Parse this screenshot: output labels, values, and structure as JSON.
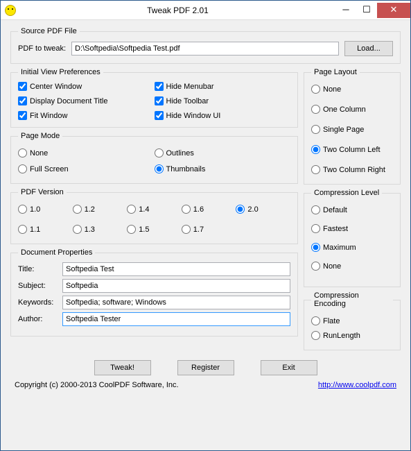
{
  "titlebar": {
    "title": "Tweak PDF 2.01"
  },
  "source": {
    "legend": "Source PDF File",
    "label": "PDF to tweak:",
    "path": "D:\\Softpedia\\Softpedia Test.pdf",
    "load": "Load..."
  },
  "initial_view": {
    "legend": "Initial View Preferences",
    "items": [
      {
        "label": "Center Window",
        "checked": true
      },
      {
        "label": "Hide Menubar",
        "checked": true
      },
      {
        "label": "Display Document Title",
        "checked": true
      },
      {
        "label": "Hide Toolbar",
        "checked": true
      },
      {
        "label": "Fit Window",
        "checked": true
      },
      {
        "label": "Hide Window UI",
        "checked": true
      }
    ]
  },
  "page_mode": {
    "legend": "Page Mode",
    "items": [
      {
        "label": "None",
        "checked": false
      },
      {
        "label": "Outlines",
        "checked": false
      },
      {
        "label": "Full Screen",
        "checked": false
      },
      {
        "label": "Thumbnails",
        "checked": true
      }
    ]
  },
  "pdf_version": {
    "legend": "PDF Version",
    "items": [
      {
        "label": "1.0",
        "checked": false
      },
      {
        "label": "1.2",
        "checked": false
      },
      {
        "label": "1.4",
        "checked": false
      },
      {
        "label": "1.6",
        "checked": false
      },
      {
        "label": "2.0",
        "checked": true
      },
      {
        "label": "1.1",
        "checked": false
      },
      {
        "label": "1.3",
        "checked": false
      },
      {
        "label": "1.5",
        "checked": false
      },
      {
        "label": "1.7",
        "checked": false
      }
    ]
  },
  "doc_props": {
    "legend": "Document Properties",
    "title_label": "Title:",
    "title": "Softpedia Test",
    "subject_label": "Subject:",
    "subject": "Softpedia",
    "keywords_label": "Keywords:",
    "keywords": "Softpedia; software; Windows",
    "author_label": "Author:",
    "author": "Softpedia Tester"
  },
  "page_layout": {
    "legend": "Page Layout",
    "items": [
      {
        "label": "None",
        "checked": false
      },
      {
        "label": "One Column",
        "checked": false
      },
      {
        "label": "Single Page",
        "checked": false
      },
      {
        "label": "Two Column Left",
        "checked": true
      },
      {
        "label": "Two Column Right",
        "checked": false
      }
    ]
  },
  "compression_level": {
    "legend": "Compression Level",
    "items": [
      {
        "label": "Default",
        "checked": false
      },
      {
        "label": "Fastest",
        "checked": false
      },
      {
        "label": "Maximum",
        "checked": true
      },
      {
        "label": "None",
        "checked": false
      }
    ]
  },
  "compression_encoding": {
    "legend": "Compression Encoding",
    "items": [
      {
        "label": "Flate",
        "checked": false
      },
      {
        "label": "RunLength",
        "checked": false
      }
    ]
  },
  "buttons": {
    "tweak": "Tweak!",
    "register": "Register",
    "exit": "Exit"
  },
  "footer": {
    "copyright": "Copyright (c) 2000-2013 CoolPDF Software, Inc.",
    "link": "http://www.coolpdf.com"
  }
}
